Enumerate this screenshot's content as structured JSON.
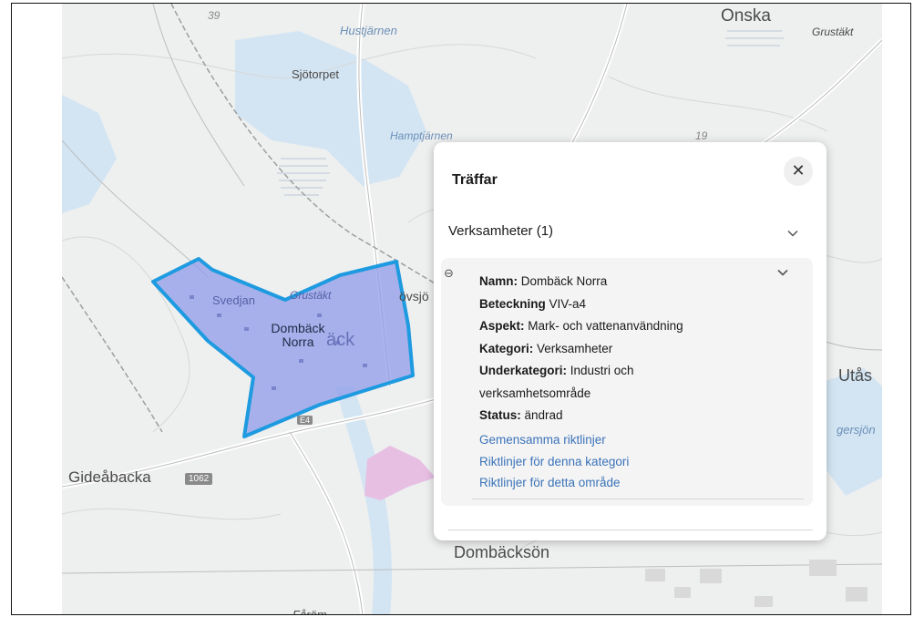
{
  "map": {
    "place_labels": [
      {
        "text": "39",
        "kind": "road"
      },
      {
        "text": "Hustjärnen",
        "kind": "water"
      },
      {
        "text": "Onska",
        "kind": "place"
      },
      {
        "text": "Grustäkt",
        "kind": "feature"
      },
      {
        "text": "Sjötorpet",
        "kind": "place"
      },
      {
        "text": "Hamptjärnen",
        "kind": "water"
      },
      {
        "text": "19",
        "kind": "road"
      },
      {
        "text": "Svedjan",
        "kind": "place"
      },
      {
        "text": "Grustäkt",
        "kind": "feature"
      },
      {
        "text": "övsjö",
        "kind": "place"
      },
      {
        "text": "äck",
        "kind": "place"
      },
      {
        "text": "Utås",
        "kind": "place"
      },
      {
        "text": "gersjön",
        "kind": "water"
      },
      {
        "text": "Gideåbacka",
        "kind": "place"
      },
      {
        "text": "1062",
        "kind": "road"
      },
      {
        "text": "Dombäcksön",
        "kind": "place"
      },
      {
        "text": "Fåröm",
        "kind": "place"
      },
      {
        "text": "E4",
        "kind": "road"
      }
    ],
    "selected_area_label": "Dombäck Norra",
    "selected_area_color": "#1e9be0",
    "selected_area_fill": "#8f9be9"
  },
  "panel": {
    "title": "Träffar",
    "close_symbol": "✕",
    "section": {
      "title": "Verksamheter (1)",
      "expanded": false
    },
    "item": {
      "toggle_symbol": "⊖",
      "fields": [
        {
          "label": "Namn:",
          "value": " Dombäck Norra"
        },
        {
          "label": "Beteckning",
          "value": " VIV-a4"
        },
        {
          "label": "Aspekt:",
          "value": " Mark- och vattenanvändning"
        },
        {
          "label": "Kategori:",
          "value": " Verksamheter"
        },
        {
          "label": "Underkategori:",
          "value": " Industri och verksamhetsområde"
        },
        {
          "label": "Status:",
          "value": " ändrad"
        }
      ],
      "links": [
        "Gemensamma riktlinjer",
        "Riktlinjer för denna kategori",
        "Riktlinjer för detta område"
      ]
    },
    "link_color": "#3b73b9"
  }
}
